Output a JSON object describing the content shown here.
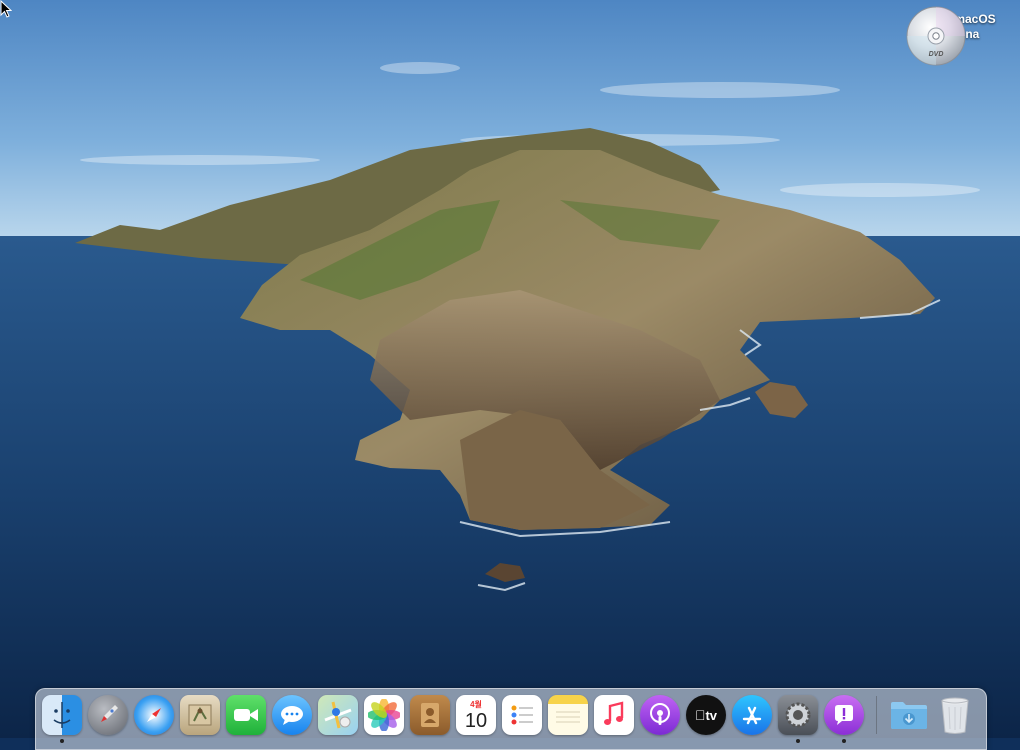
{
  "desktop": {
    "wallpaper": "macOS Catalina island",
    "icons": [
      {
        "label": "Install macOS Catalina",
        "icon": "dvd-disc-icon"
      }
    ]
  },
  "dock": {
    "apps": [
      {
        "name": "Finder",
        "icon": "finder-icon",
        "running": true
      },
      {
        "name": "Launchpad",
        "icon": "launchpad-icon"
      },
      {
        "name": "Safari",
        "icon": "safari-icon"
      },
      {
        "name": "Mail",
        "icon": "mail-icon"
      },
      {
        "name": "FaceTime",
        "icon": "facetime-icon"
      },
      {
        "name": "Messages",
        "icon": "messages-icon"
      },
      {
        "name": "Maps",
        "icon": "maps-icon"
      },
      {
        "name": "Photos",
        "icon": "photos-icon"
      },
      {
        "name": "Contacts",
        "icon": "contacts-icon"
      },
      {
        "name": "Calendar",
        "icon": "calendar-icon",
        "month": "4월",
        "day": "10"
      },
      {
        "name": "Reminders",
        "icon": "reminders-icon"
      },
      {
        "name": "Notes",
        "icon": "notes-icon"
      },
      {
        "name": "Music",
        "icon": "music-icon"
      },
      {
        "name": "Podcasts",
        "icon": "podcasts-icon"
      },
      {
        "name": "TV",
        "icon": "apple-tv-icon",
        "text": "tv"
      },
      {
        "name": "App Store",
        "icon": "app-store-icon"
      },
      {
        "name": "System Preferences",
        "icon": "system-preferences-icon",
        "running": true
      },
      {
        "name": "Feedback Assistant",
        "icon": "feedback-assistant-icon",
        "running": true
      }
    ],
    "stack": [
      {
        "name": "Downloads",
        "icon": "downloads-folder-icon"
      },
      {
        "name": "Trash",
        "icon": "trash-icon"
      }
    ]
  }
}
